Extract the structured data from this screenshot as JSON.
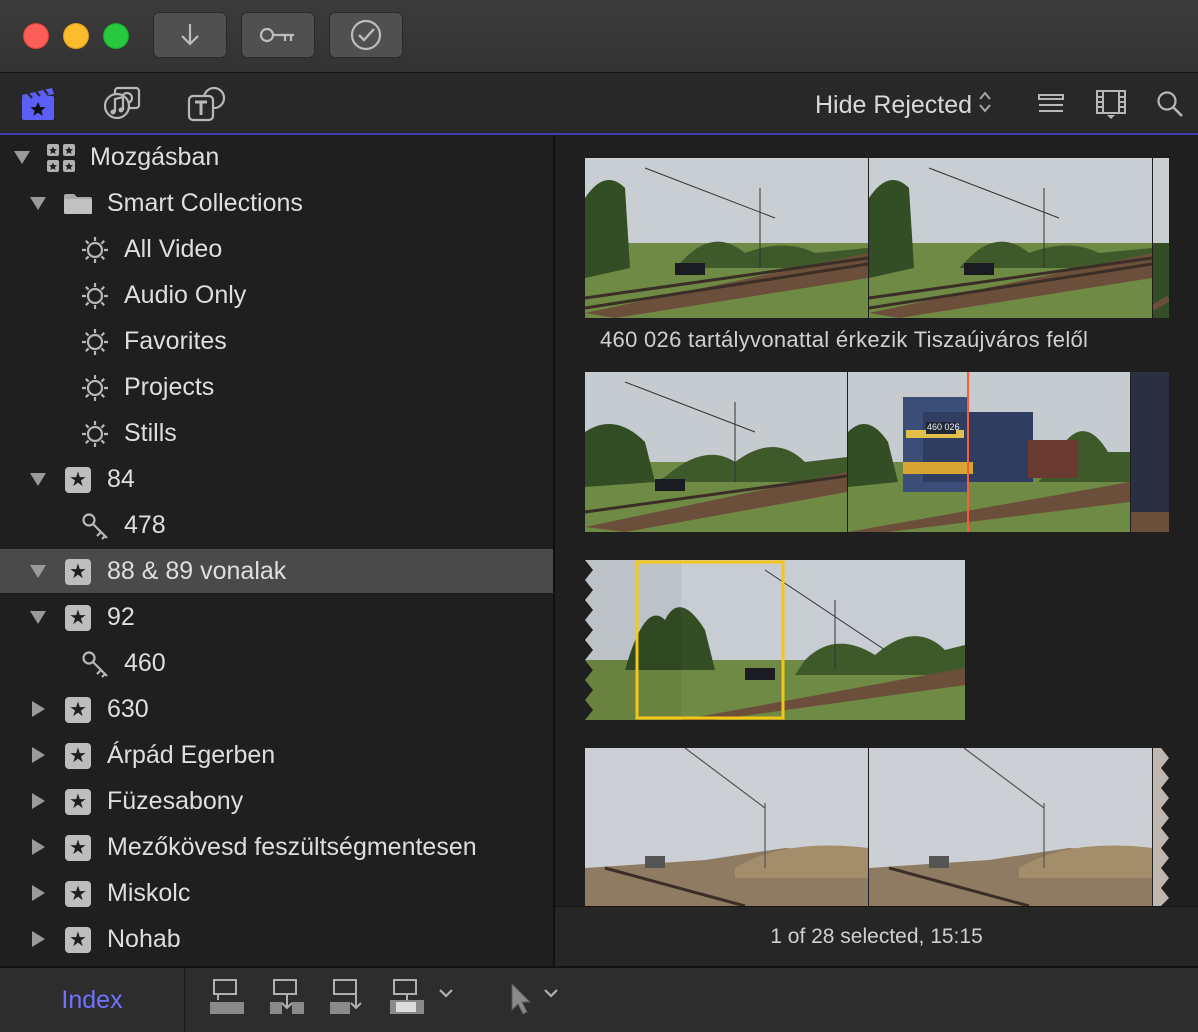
{
  "titlebar": {
    "buttons": [
      {
        "name": "import-button",
        "icon": "arrow-down-icon"
      },
      {
        "name": "keywords-button",
        "icon": "key-icon"
      },
      {
        "name": "background-tasks-button",
        "icon": "checkmark-circle-icon"
      }
    ]
  },
  "toolbar": {
    "filter_label": "Hide Rejected",
    "icons": [
      "libraries-icon",
      "photos-audio-icon",
      "titles-generators-icon",
      "list-view-icon",
      "filmstrip-view-icon",
      "search-icon"
    ]
  },
  "sidebar": {
    "items": [
      {
        "label": "Mozgásban",
        "icon": "library-icon",
        "expanded": true
      },
      {
        "label": "Smart Collections",
        "icon": "folder-icon",
        "expanded": true
      },
      {
        "label": "All Video",
        "icon": "smart-collection-icon"
      },
      {
        "label": "Audio Only",
        "icon": "smart-collection-icon"
      },
      {
        "label": "Favorites",
        "icon": "smart-collection-icon"
      },
      {
        "label": "Projects",
        "icon": "smart-collection-icon"
      },
      {
        "label": "Stills",
        "icon": "smart-collection-icon"
      },
      {
        "label": "84",
        "icon": "event-star-icon",
        "expanded": true
      },
      {
        "label": "478",
        "icon": "keyword-icon"
      },
      {
        "label": "88 & 89 vonalak",
        "icon": "event-star-icon",
        "expanded": true,
        "selected": true
      },
      {
        "label": "92",
        "icon": "event-star-icon",
        "expanded": true
      },
      {
        "label": "460",
        "icon": "keyword-icon"
      },
      {
        "label": "630",
        "icon": "event-star-icon",
        "expanded": false
      },
      {
        "label": "Árpád Egerben",
        "icon": "event-star-icon",
        "expanded": false
      },
      {
        "label": "Füzesabony",
        "icon": "event-star-icon",
        "expanded": false
      },
      {
        "label": "Mezőkövesd feszültségmentesen",
        "icon": "event-star-icon",
        "expanded": false
      },
      {
        "label": "Miskolc",
        "icon": "event-star-icon",
        "expanded": false
      },
      {
        "label": "Nohab",
        "icon": "event-star-icon",
        "expanded": false
      }
    ]
  },
  "browser": {
    "clip_title": "460 026 tartályvonattal érkezik Tiszaújváros felől",
    "locomotive_number": "460 026",
    "status": "1 of 28 selected, 15:15"
  },
  "bottombar": {
    "index_label": "Index",
    "icons": [
      "connect-clip-icon",
      "insert-clip-icon",
      "append-clip-icon",
      "overwrite-clip-icon",
      "edit-options-chevron-icon",
      "select-tool-icon",
      "tools-chevron-icon"
    ]
  },
  "colors": {
    "accent": "#6f72ff",
    "playhead": "#ff5a36",
    "selection": "#f5c518"
  }
}
